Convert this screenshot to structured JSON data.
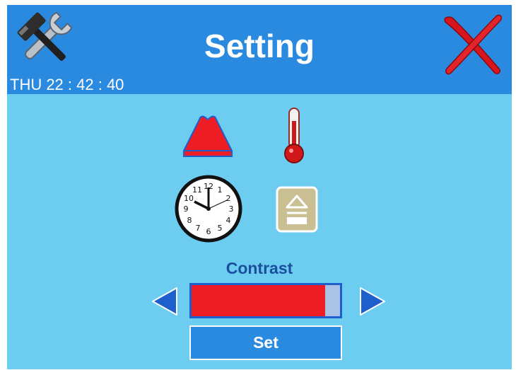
{
  "header": {
    "title": "Setting",
    "datetime": "THU 22 : 42 : 40"
  },
  "icons": {
    "tools": "tools-icon",
    "close": "close-icon",
    "brightness": "brightness-icon",
    "temperature": "thermometer-icon",
    "clock": "clock-icon",
    "eject": "eject-icon"
  },
  "contrast": {
    "label": "Contrast",
    "level": 0.9,
    "decrease_icon": "arrow-left-icon",
    "increase_icon": "arrow-right-icon"
  },
  "set_button": {
    "label": "Set"
  },
  "colors": {
    "header_bg": "#2a8ae0",
    "panel_bg": "#6dcdf1",
    "bar_fill": "#ee1d25",
    "bar_border": "#1f5fcc",
    "label_text": "#1a4fa0"
  }
}
